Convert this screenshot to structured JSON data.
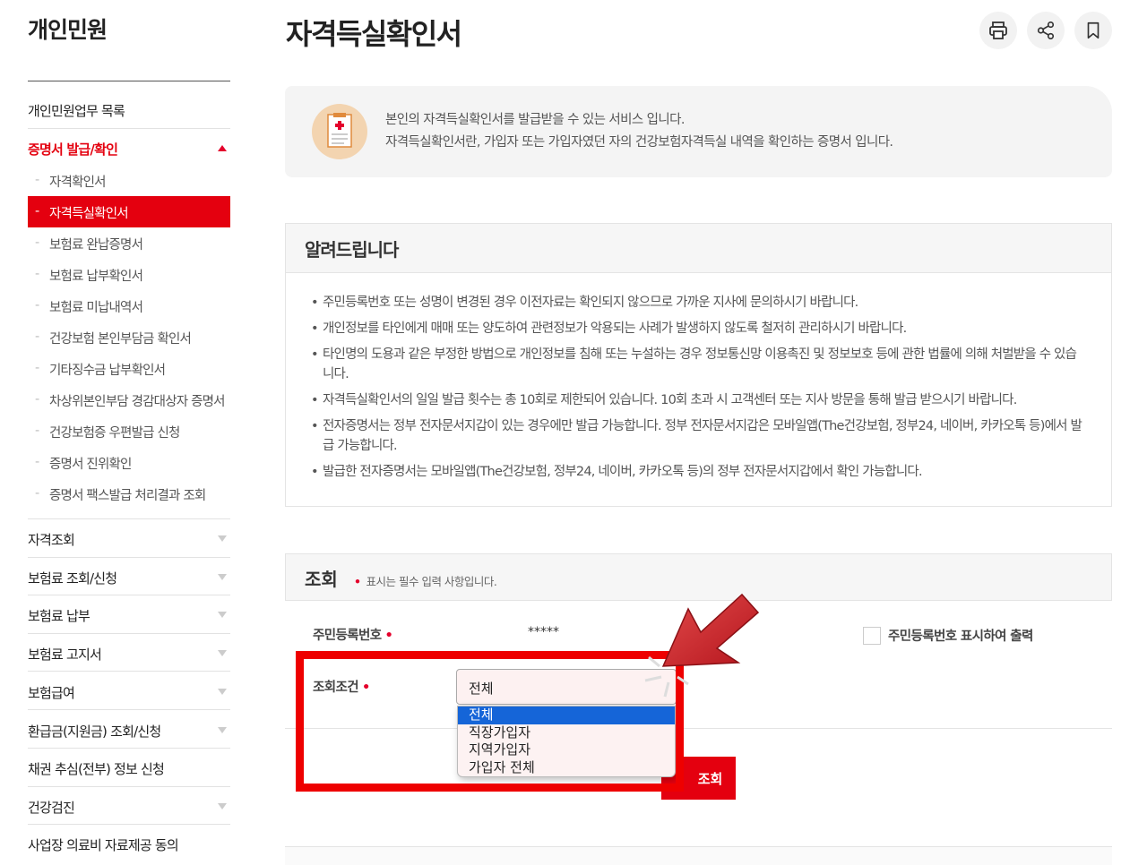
{
  "sidebar": {
    "title": "개인민원",
    "menu_top": "개인민원업무 목록",
    "section_active": "증명서 발급/확인",
    "sub_items": [
      "자격확인서",
      "자격득실확인서",
      "보험료 완납증명서",
      "보험료 납부확인서",
      "보험료 미납내역서",
      "건강보험 본인부담금 확인서",
      "기타징수금 납부확인서",
      "차상위본인부담 경감대상자 증명서",
      "건강보험증 우편발급 신청",
      "증명서 진위확인",
      "증명서 팩스발급 처리결과 조회"
    ],
    "active_sub_index": 1,
    "sections": [
      "자격조회",
      "보험료 조회/신청",
      "보험료 납부",
      "보험료 고지서",
      "보험급여",
      "환급금(지원금) 조회/신청",
      "채권 추심(전부) 정보 신청",
      "건강검진",
      "사업장 의료비 자료제공 동의"
    ]
  },
  "page": {
    "title": "자격득실확인서"
  },
  "intro": {
    "line1": "본인의 자격득실확인서를 발급받을 수 있는 서비스 입니다.",
    "line2": "자격득실확인서란, 가입자 또는 가입자였던 자의 건강보험자격득실 내역을 확인하는 증명서 입니다."
  },
  "notice": {
    "title": "알려드립니다",
    "items": [
      "주민등록번호 또는 성명이 변경된 경우 이전자료는 확인되지 않으므로 가까운 지사에 문의하시기 바랍니다.",
      "개인정보를 타인에게 매매 또는 양도하여 관련정보가 악용되는 사례가 발생하지 않도록 철저히 관리하시기 바랍니다.",
      "타인명의 도용과 같은 부정한 방법으로 개인정보를 침해 또는 누설하는 경우 정보통신망 이용촉진 및 정보보호 등에 관한 법률에 의해 처벌받을 수 있습니다.",
      "자격득실확인서의 일일 발급 횟수는 총 10회로 제한되어 있습니다. 10회 초과 시 고객센터 또는 지사 방문을 통해 발급 받으시기 바랍니다.",
      "전자증명서는 정부 전자문서지갑이 있는 경우에만 발급 가능합니다. 정부 전자문서지갑은 모바일앱(The건강보험, 정부24, 네이버, 카카오톡 등)에서 발급 가능합니다.",
      "발급한 전자증명서는 모바일앱(The건강보험, 정부24, 네이버, 카카오톡 등)의 정부 전자문서지갑에서 확인 가능합니다."
    ]
  },
  "search": {
    "title": "조회",
    "required_note": "표시는 필수 입력 사항입니다.",
    "rrn_label": "주민등록번호",
    "rrn_value": "*****",
    "rrn_print_label": "주민등록번호 표시하여 출력",
    "condition_label": "조회조건",
    "condition_selected": "전체",
    "condition_options": [
      "전체",
      "직장가입자",
      "지역가입자",
      "가입자 전체"
    ],
    "button_label": "조회"
  },
  "colors": {
    "accent": "#e4000f",
    "dropdown_selected": "#1565d8"
  }
}
